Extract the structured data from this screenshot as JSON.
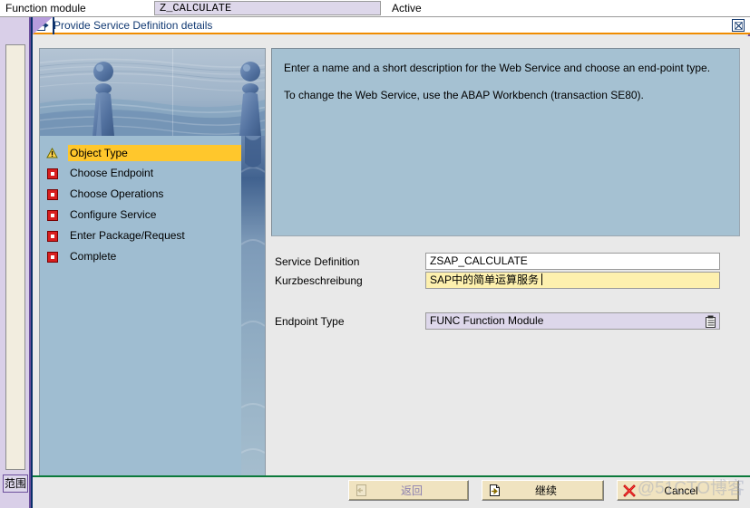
{
  "background_window": {
    "fm_label": "Function module",
    "fm_value": "Z_CALCULATE",
    "status": "Active",
    "scope_label": "范围"
  },
  "dialog": {
    "title": "Provide Service Definition details",
    "icon": "export-window-icon",
    "close_icon": "close-icon"
  },
  "wizard": {
    "image_name": "chess-pawns-water-banner",
    "steps": [
      {
        "label": "Object Type",
        "icon": "warning-triangle-icon",
        "state": "active"
      },
      {
        "label": "Choose Endpoint",
        "icon": "red-square-icon",
        "state": "pending"
      },
      {
        "label": "Choose Operations",
        "icon": "red-square-icon",
        "state": "pending"
      },
      {
        "label": "Configure Service",
        "icon": "red-square-icon",
        "state": "pending"
      },
      {
        "label": "Enter Package/Request",
        "icon": "red-square-icon",
        "state": "pending"
      },
      {
        "label": "Complete",
        "icon": "red-square-icon",
        "state": "pending"
      }
    ]
  },
  "description": {
    "paragraph1": "Enter a name and a short description for the Web Service and choose an end-point type.",
    "paragraph2": "To change the Web Service, use the ABAP Workbench (transaction SE80)."
  },
  "form": {
    "service_definition": {
      "label": "Service Definition",
      "value": "ZSAP_CALCULATE"
    },
    "short_description": {
      "label": "Kurzbeschreibung",
      "value": "SAP中的简单运算服务"
    },
    "endpoint_type": {
      "label": "Endpoint Type",
      "value": "FUNC Function Module",
      "picker_icon": "value-help-list-icon"
    }
  },
  "footer": {
    "buttons": [
      {
        "label": "返回",
        "icon": "back-arrow-icon",
        "enabled": false
      },
      {
        "label": "继续",
        "icon": "continue-document-arrow-icon",
        "enabled": true
      },
      {
        "label": "Cancel",
        "icon": "red-x-icon",
        "enabled": true
      }
    ]
  },
  "watermark": {
    "text": "@51CTO博客"
  },
  "colors": {
    "accent_orange": "#f08c00",
    "accent_green": "#0b7a3b",
    "title_blue": "#123a73",
    "panel_blue": "#a5c1d2",
    "sidebar_blue": "#9fbdd1",
    "highlight_yellow": "#ffc72c",
    "focus_field_yellow": "#fdf0ae",
    "readonly_lavender": "#ddd7ea",
    "button_beige": "#f0e3c0"
  }
}
